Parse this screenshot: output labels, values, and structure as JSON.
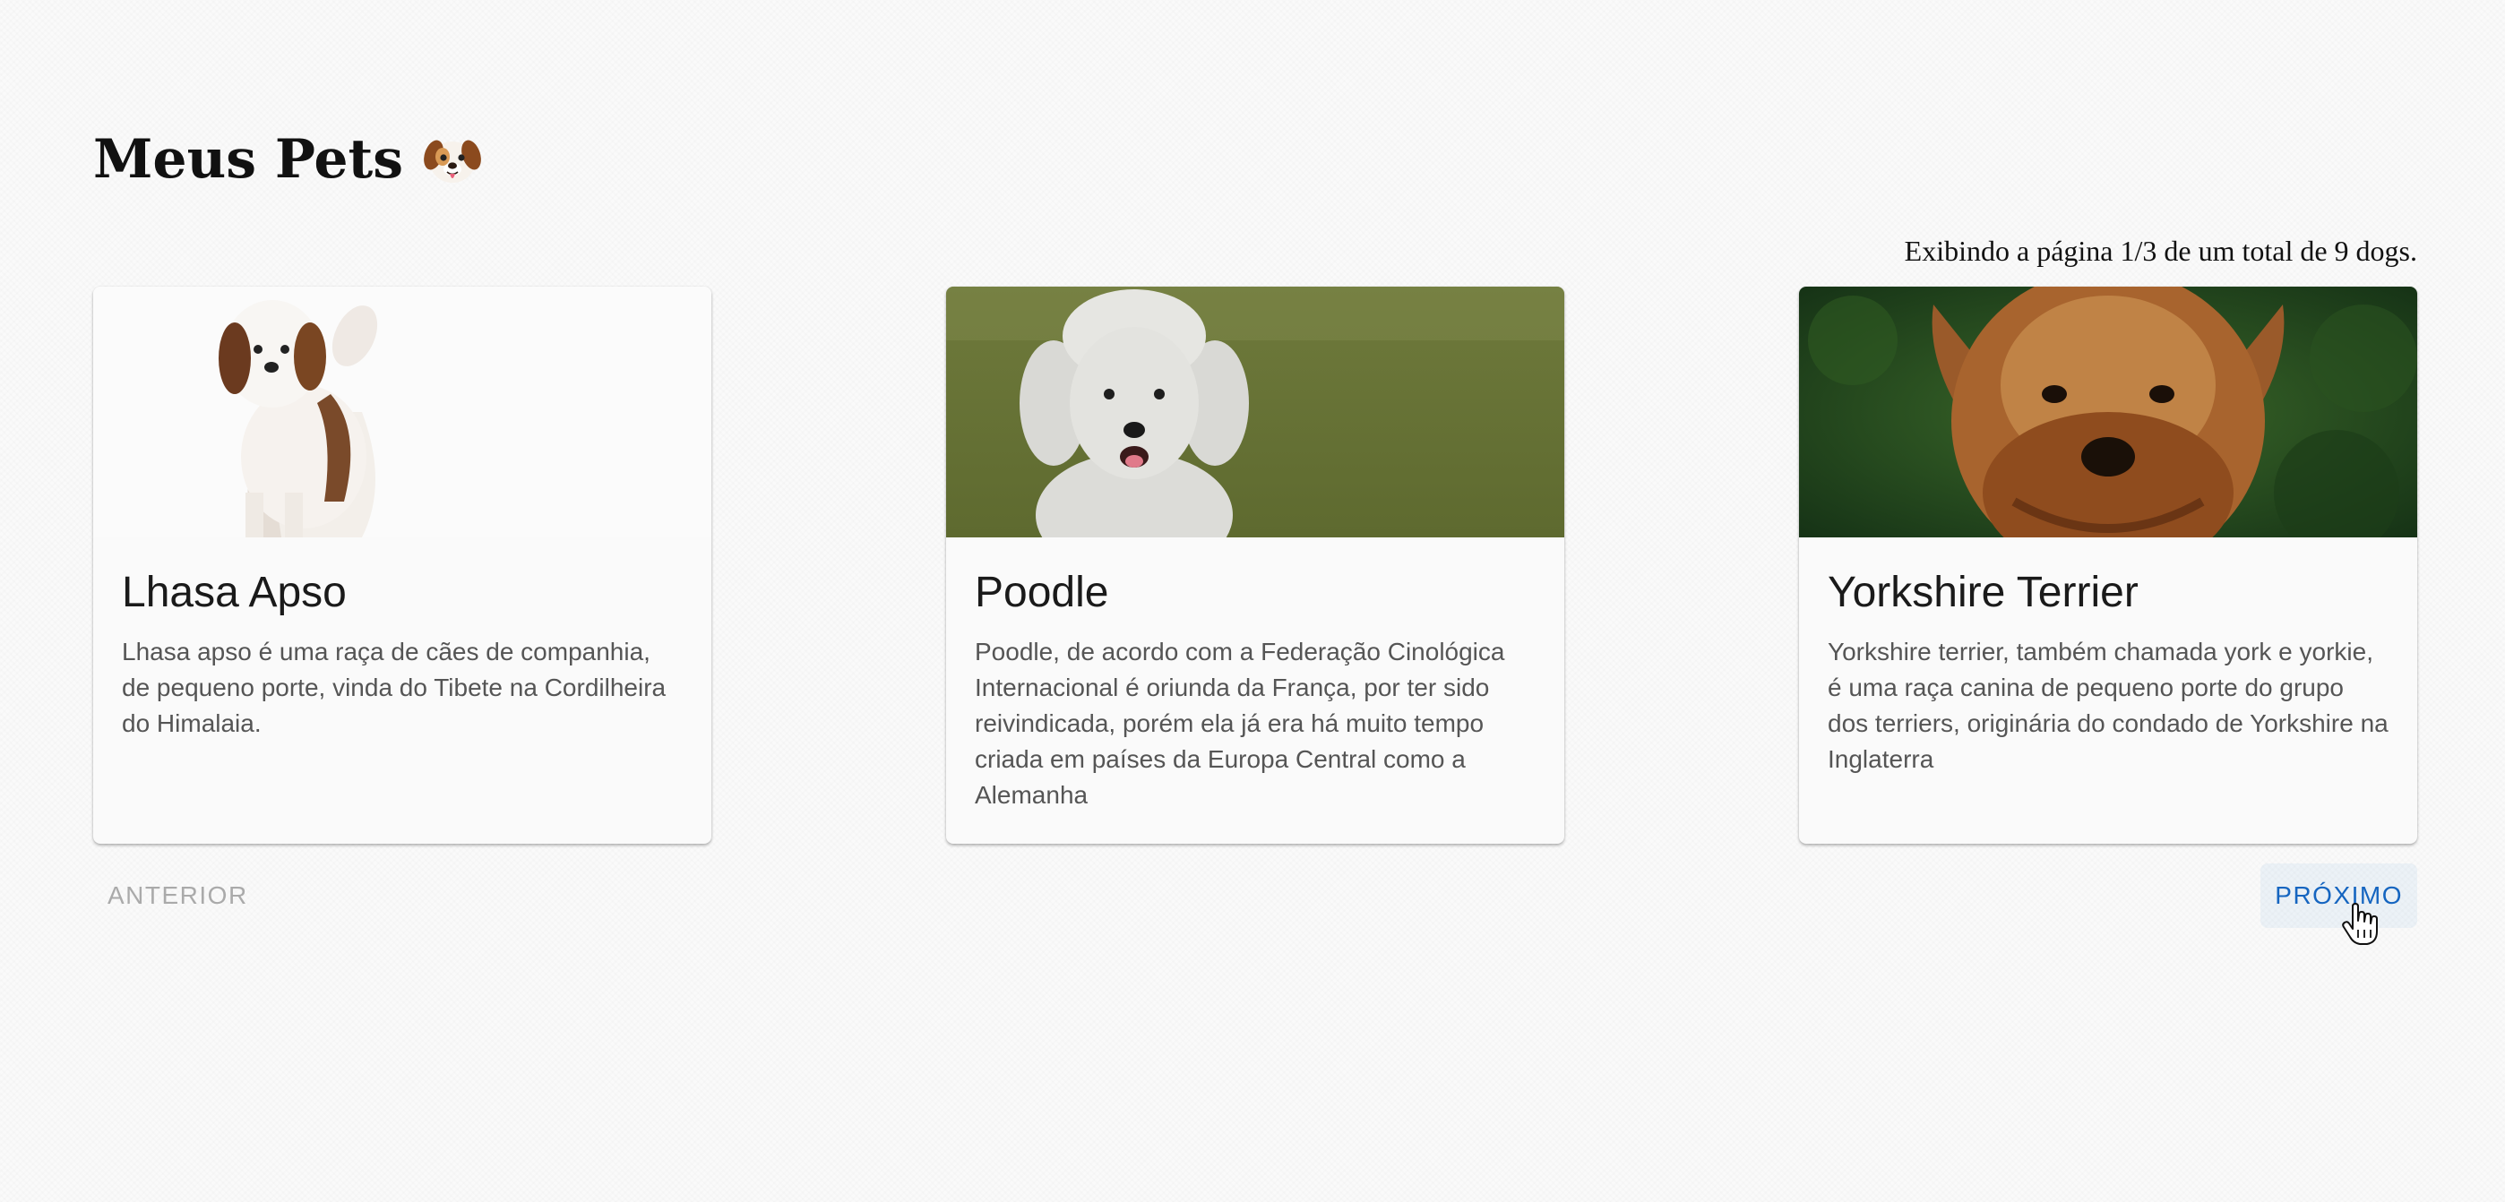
{
  "header": {
    "title": "Meus Pets",
    "emoji_icon": "puppy-face-icon"
  },
  "pagination": {
    "status_text": "Exibindo a página 1/3 de um total de 9 dogs.",
    "prev_label": "ANTERIOR",
    "next_label": "PRÓXIMO",
    "prev_disabled": true
  },
  "cards": [
    {
      "title": "Lhasa Apso",
      "description": "Lhasa apso é uma raça de cães de companhia, de pequeno porte, vinda do Tibete na Cordilheira do Himalaia.",
      "image": "lhasa-apso-photo"
    },
    {
      "title": "Poodle",
      "description": "Poodle, de acordo com a Federação Cinológica Internacional é oriunda da França, por ter sido reivindicada, porém ela já era há muito tempo criada em países da Europa Central como a Alemanha",
      "image": "poodle-photo"
    },
    {
      "title": "Yorkshire Terrier",
      "description": "Yorkshire terrier, também chamada york e yorkie, é uma raça canina de pequeno porte do grupo dos terriers, originária do condado de Yorkshire na Inglaterra",
      "image": "yorkshire-terrier-photo"
    }
  ],
  "colors": {
    "primary": "#1565c0",
    "disabled": "#aaaaaa",
    "background": "#fafafa"
  }
}
